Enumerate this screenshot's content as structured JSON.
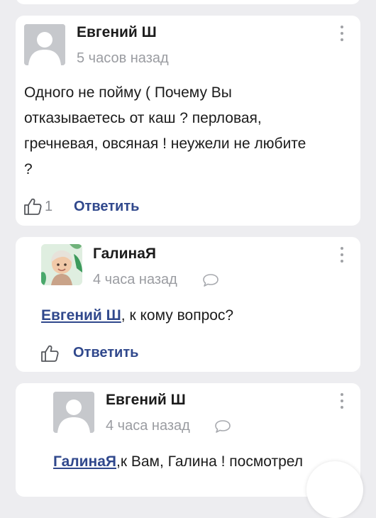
{
  "comments": [
    {
      "author": "Евгений Ш",
      "time": "5 часов назад",
      "text_lines": [
        "Одного не пойму ( Почему Вы",
        "отказываетесь от каш ? перловая,",
        "гречневая, овсяная ! неужели не любите",
        "?"
      ],
      "likes": "1",
      "reply_label": "Ответить",
      "avatar": "default-user-avatar",
      "menu_icon": "more-vertical-icon",
      "like_icon": "thumbs-up-icon"
    },
    {
      "author": "ГалинаЯ",
      "time": "4 часа назад",
      "mention": "Евгений Ш",
      "text_rest": ", к кому вопрос?",
      "reply_label": "Ответить",
      "avatar": "memoji-avatar",
      "menu_icon": "more-vertical-icon",
      "like_icon": "thumbs-up-icon",
      "comment_icon": "speech-bubble-icon"
    },
    {
      "author": "Евгений Ш",
      "time": "4 часа назад",
      "mention": "ГалинаЯ",
      "text_rest": ",к Вам, Галина ! посмотрел",
      "avatar": "default-user-avatar",
      "menu_icon": "more-vertical-icon",
      "comment_icon": "speech-bubble-icon"
    }
  ],
  "colors": {
    "background": "#ededf0",
    "card": "#ffffff",
    "link": "#30488c",
    "muted": "#9a9ca1"
  }
}
